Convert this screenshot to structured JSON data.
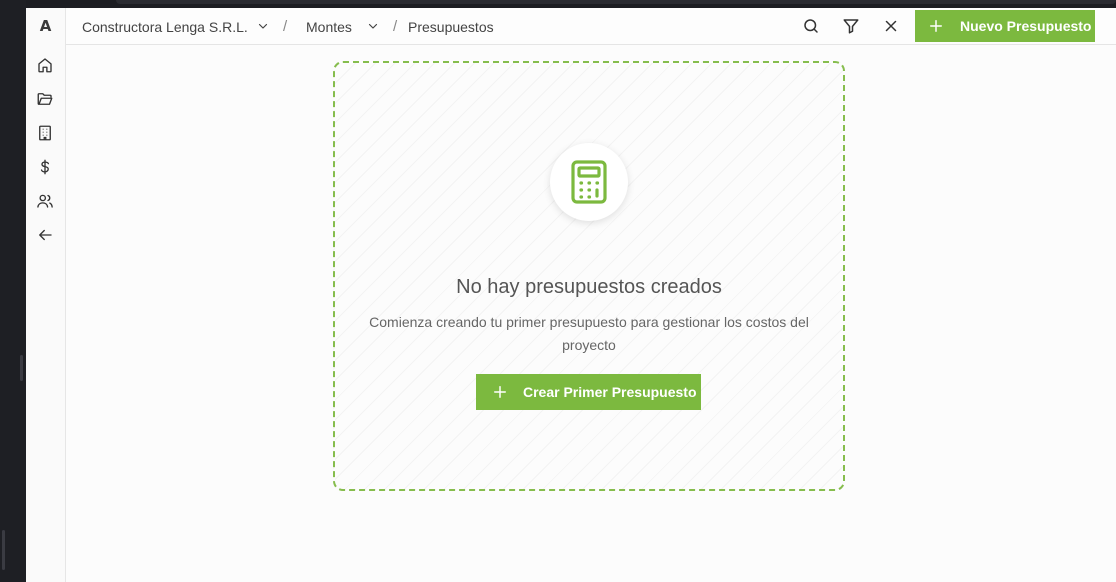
{
  "app": {
    "logo": "A"
  },
  "sidebar": {
    "items": [
      {
        "name": "home",
        "icon": "home-icon"
      },
      {
        "name": "projects",
        "icon": "folder-open-icon"
      },
      {
        "name": "buildings",
        "icon": "building-icon"
      },
      {
        "name": "finance",
        "icon": "dollar-icon"
      },
      {
        "name": "users",
        "icon": "users-icon"
      },
      {
        "name": "back",
        "icon": "arrow-left-icon"
      }
    ]
  },
  "header": {
    "breadcrumb": {
      "company": "Constructora Lenga S.R.L.",
      "project": "Montes",
      "separator": "/",
      "current": "Presupuestos"
    },
    "actions": {
      "search": "search-icon",
      "filter": "filter-icon",
      "clear": "close-icon"
    },
    "new_button_label": "Nuevo Presupuesto"
  },
  "empty_state": {
    "icon": "calculator-icon",
    "title": "No hay presupuestos creados",
    "description": "Comienza creando tu primer presupuesto para gestionar los costos del proyecto",
    "button_label": "Crear Primer Presupuesto"
  },
  "colors": {
    "accent": "#7cb93f",
    "dashed_border": "#86bd4d",
    "text": "#444444"
  }
}
